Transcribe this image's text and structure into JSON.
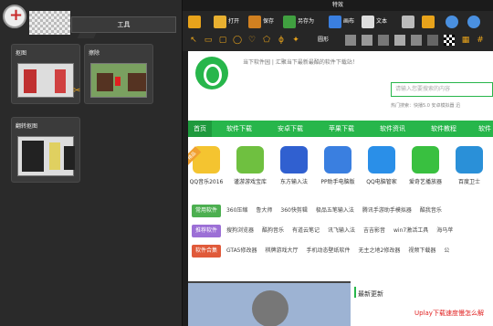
{
  "window": {
    "title": "特效"
  },
  "left": {
    "tool_header": "工具",
    "cards": [
      {
        "label": "抠图"
      },
      {
        "label": "擦除"
      },
      {
        "label": "翻转抠图"
      }
    ]
  },
  "toolbar": {
    "open": "打开",
    "save": "保存",
    "saveas": "另存为",
    "paste": "画布",
    "text": "文本",
    "blend": "圆形"
  },
  "web": {
    "slogan": "当下软件园 | 汇聚当下最新最酷的软件下载站！",
    "search_placeholder": "请输入您要搜索的内容",
    "hot": "热门搜索：快播5.0  安卓模拟器  迅",
    "nav": [
      "首页",
      "软件下载",
      "安卓下载",
      "苹果下载",
      "软件资讯",
      "软件教程",
      "软件专"
    ],
    "apps": [
      {
        "name": "QQ音乐2016",
        "badge": "精品",
        "color": "#f4c430"
      },
      {
        "name": "谨游游戏宝库",
        "color": "#6fc040"
      },
      {
        "name": "东方输入法",
        "color": "#3060d0"
      },
      {
        "name": "PP助手电脑版",
        "color": "#3a7fe0"
      },
      {
        "name": "QQ电脑管家",
        "color": "#2a8fe8"
      },
      {
        "name": "爱奇艺播放器",
        "color": "#39c040"
      },
      {
        "name": "百度卫士",
        "color": "#2a90d8"
      }
    ],
    "rows": [
      {
        "cat": "常用软件",
        "color": "#4caf50",
        "items": [
          "360压缩",
          "鲁大师",
          "360快剪辑",
          "极品五笔输入法",
          "腾讯手游助手模拟器",
          "酷我音乐"
        ]
      },
      {
        "cat": "推荐软件",
        "color": "#9c6fd6",
        "items": [
          "搜狗浏览器",
          "酷狗音乐",
          "有道云笔记",
          "讯飞输入法",
          "吉吉影音",
          "win7激活工具",
          "海马苹"
        ]
      },
      {
        "cat": "软件合集",
        "color": "#e05a3a",
        "items": [
          "GTA5修改器",
          "棋牌游戏大厅",
          "手机动态壁纸软件",
          "无主之地2修改器",
          "视频下载器",
          "公"
        ]
      }
    ],
    "latest": "最新更新",
    "uplay": "Uplay下载速度慢怎么解"
  }
}
